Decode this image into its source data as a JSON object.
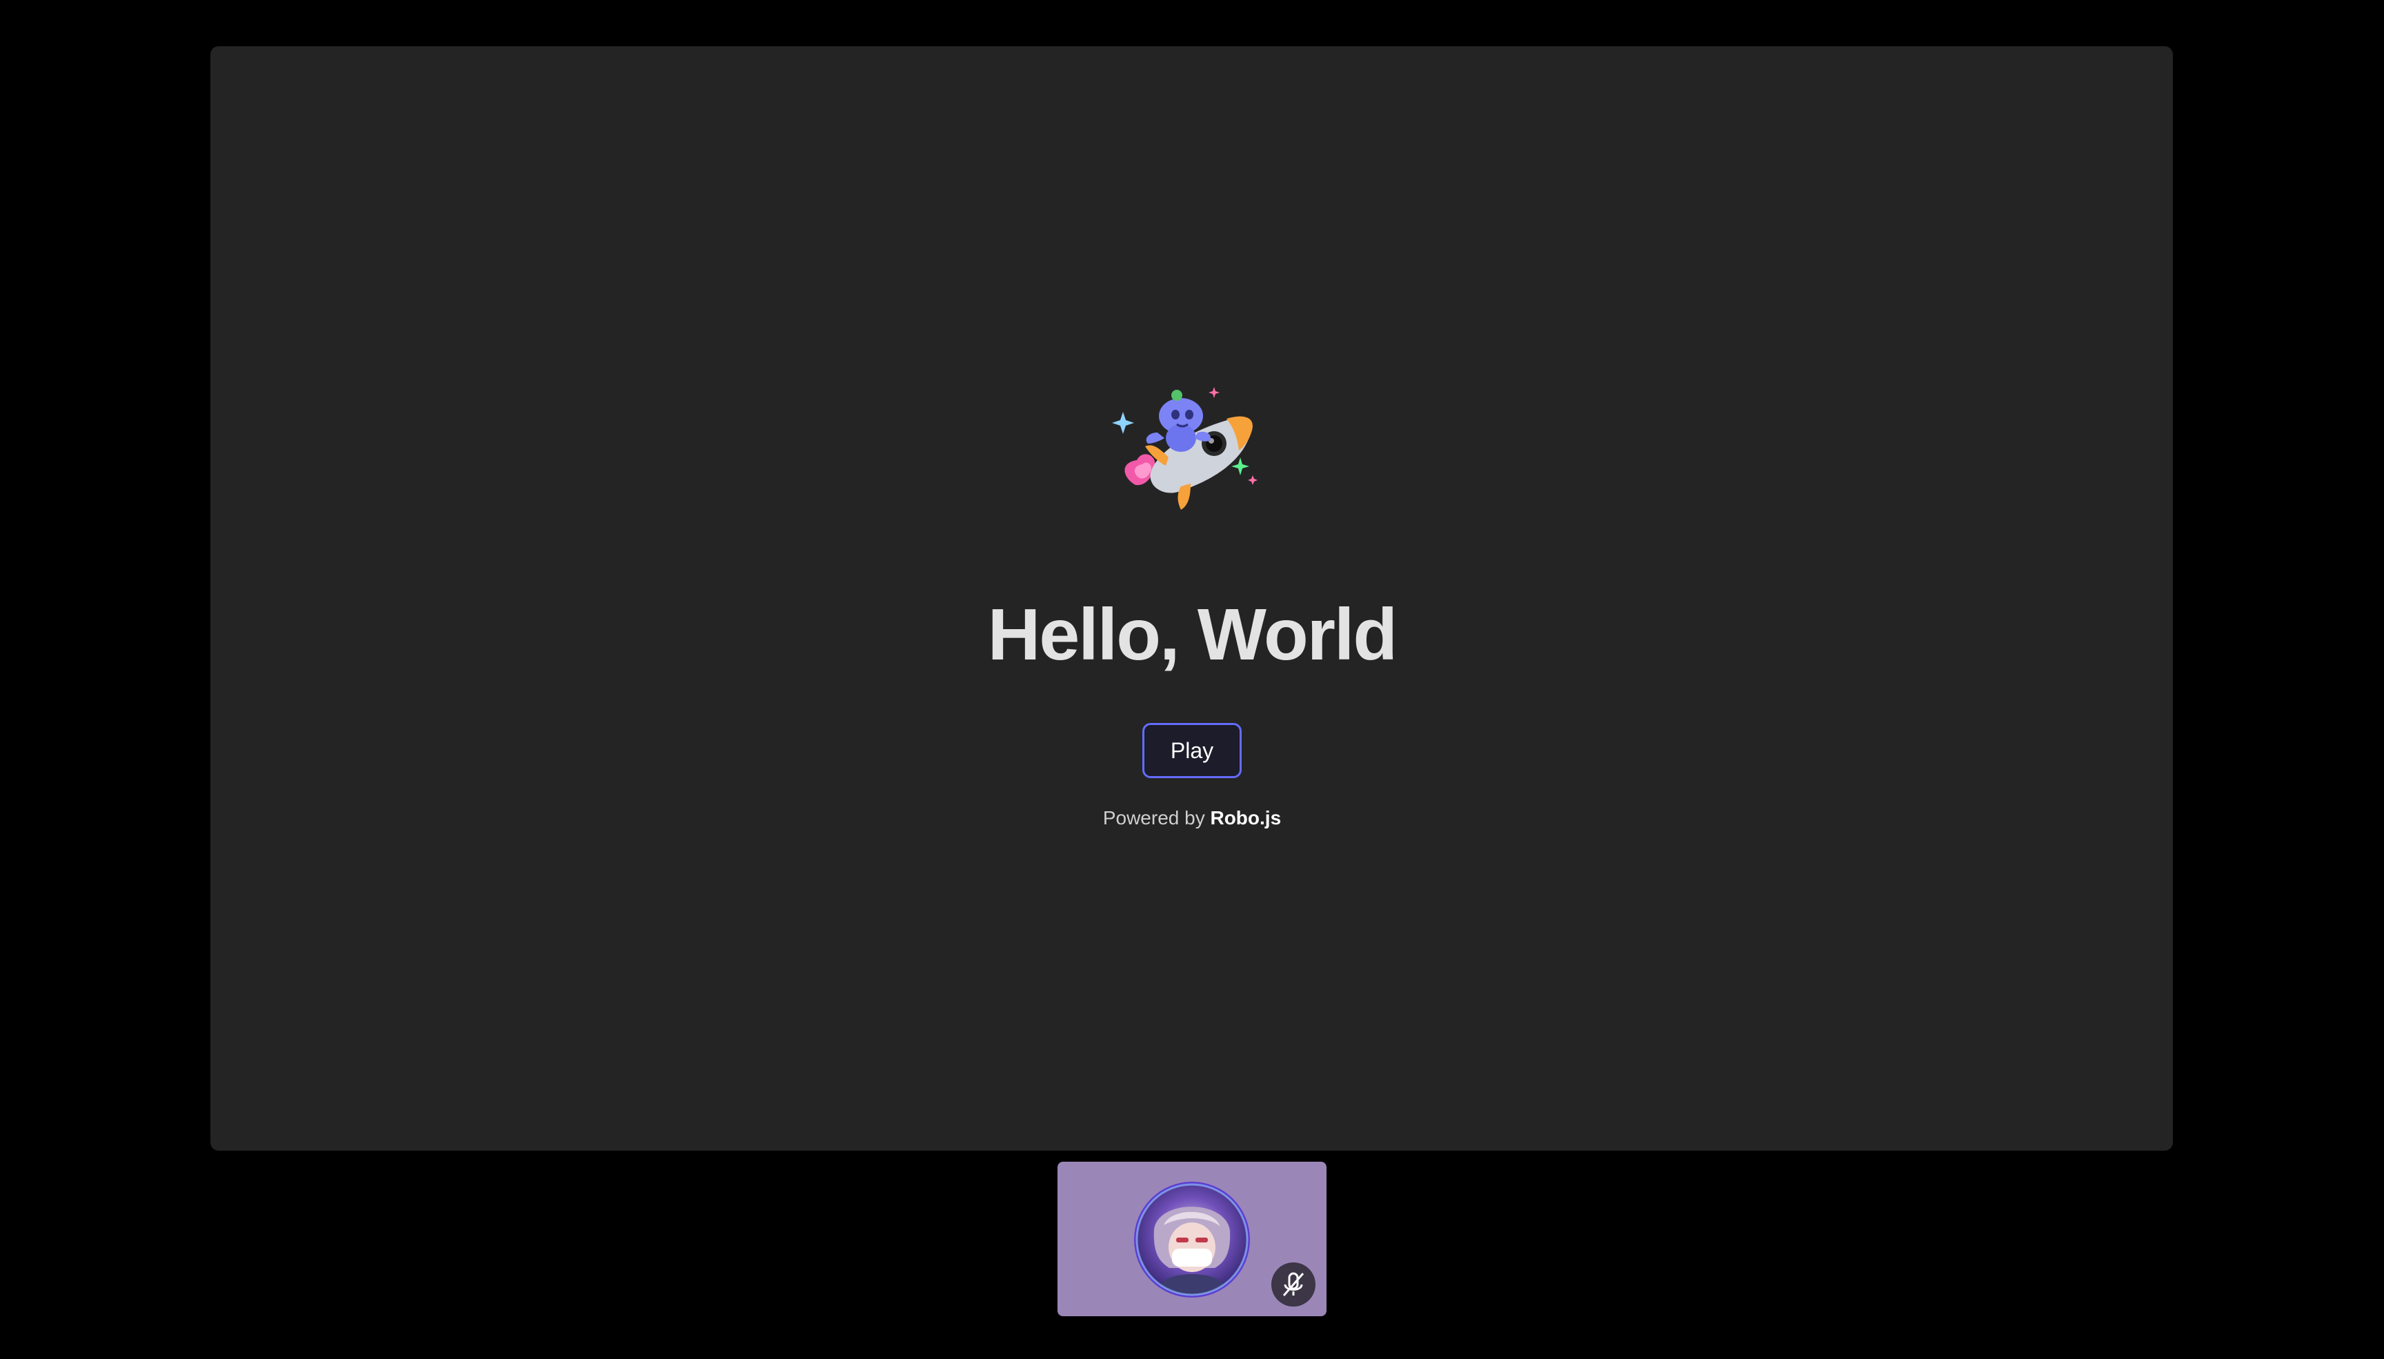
{
  "activity": {
    "title": "Hello, World",
    "play_label": "Play",
    "powered_prefix": "Powered by",
    "powered_brand": "Robo.js",
    "logo_icon": "rocket-mascot-icon",
    "accent_color": "#646cff"
  },
  "participant": {
    "avatar_icon": "user-avatar",
    "status_icon": "microphone-muted-icon",
    "tile_color": "#9b86b8"
  }
}
